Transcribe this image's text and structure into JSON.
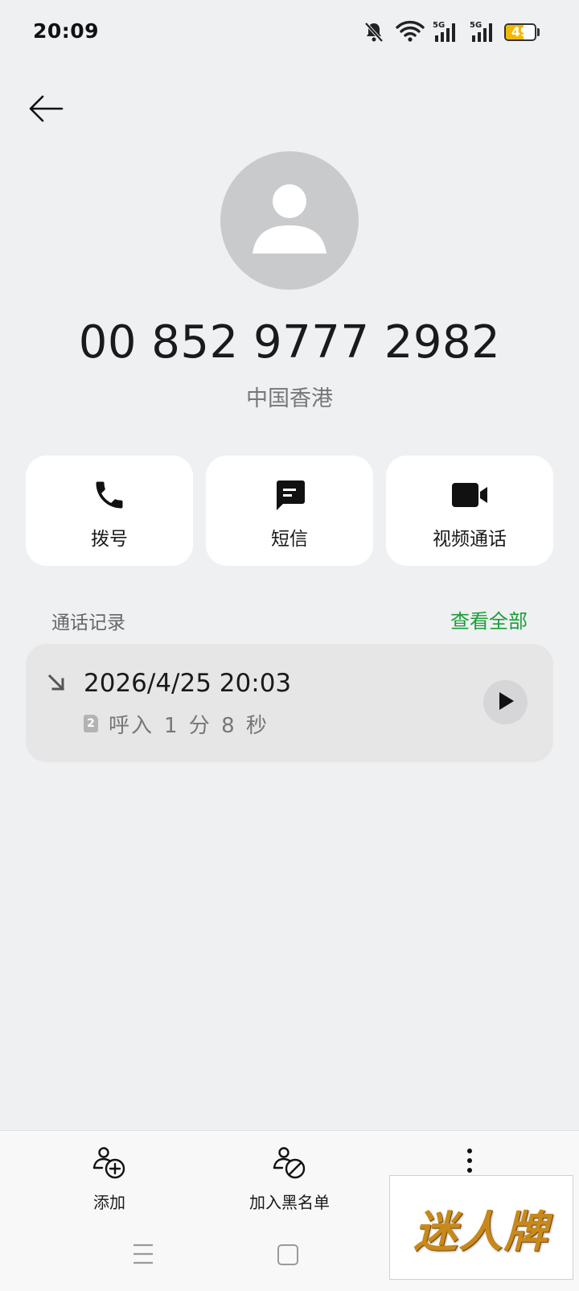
{
  "status_bar": {
    "time": "20:09",
    "battery_level": "49",
    "network_label": "5G",
    "icons": [
      "mute-bell-icon",
      "wifi-icon",
      "signal-5g-icon",
      "signal-5g-icon",
      "battery-icon"
    ]
  },
  "contact": {
    "phone_number": "00 852 9777 2982",
    "region": "中国香港"
  },
  "actions": {
    "dial": "拨号",
    "sms": "短信",
    "video_call": "视频通话"
  },
  "call_log": {
    "title": "通话记录",
    "view_all": "查看全部",
    "entries": [
      {
        "datetime": "2026/4/25 20:03",
        "sim": "2",
        "type": "呼入",
        "duration": "1 分 8 秒"
      }
    ]
  },
  "bottom_actions": {
    "add": "添加",
    "blacklist": "加入黑名单"
  },
  "watermark": "迷人牌",
  "colors": {
    "background": "#eff0f2",
    "accent_green": "#1a9e36",
    "battery_yellow": "#f2b705",
    "avatar_gray": "#c9cacc"
  }
}
